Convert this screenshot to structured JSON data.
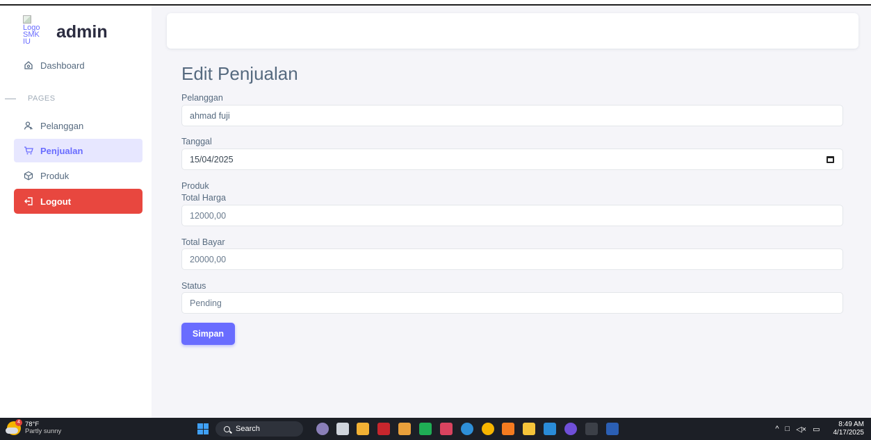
{
  "brand": {
    "logo_alt": "Logo SMK IU",
    "logo_lines": [
      "Logo",
      "SMK",
      "IU"
    ],
    "name": "admin"
  },
  "sidebar": {
    "section_header": "PAGES",
    "items": [
      {
        "label": "Dashboard",
        "icon": "home-icon"
      },
      {
        "label": "Pelanggan",
        "icon": "user-icon"
      },
      {
        "label": "Penjualan",
        "icon": "cart-icon",
        "active": true
      },
      {
        "label": "Produk",
        "icon": "box-icon"
      },
      {
        "label": "Logout",
        "icon": "logout-icon"
      }
    ]
  },
  "form": {
    "title": "Edit Penjualan",
    "pelanggan_label": "Pelanggan",
    "pelanggan_value": "ahmad fuji",
    "tanggal_label": "Tanggal",
    "tanggal_value": "15/04/2025",
    "produk_label": "Produk",
    "total_harga_label": "Total Harga",
    "total_harga_value": "12000,00",
    "total_bayar_label": "Total Bayar",
    "total_bayar_value": "20000,00",
    "status_label": "Status",
    "status_value": "Pending",
    "submit_label": "Simpan"
  },
  "taskbar": {
    "weather_temp": "78°F",
    "weather_desc": "Partly sunny",
    "weather_badge": "4",
    "search_label": "Search",
    "time": "8:49 AM",
    "date": "4/17/2025",
    "colors": {
      "accent": "#696cff",
      "logout": "#e8473f",
      "active_bg": "#e7e7ff"
    }
  }
}
